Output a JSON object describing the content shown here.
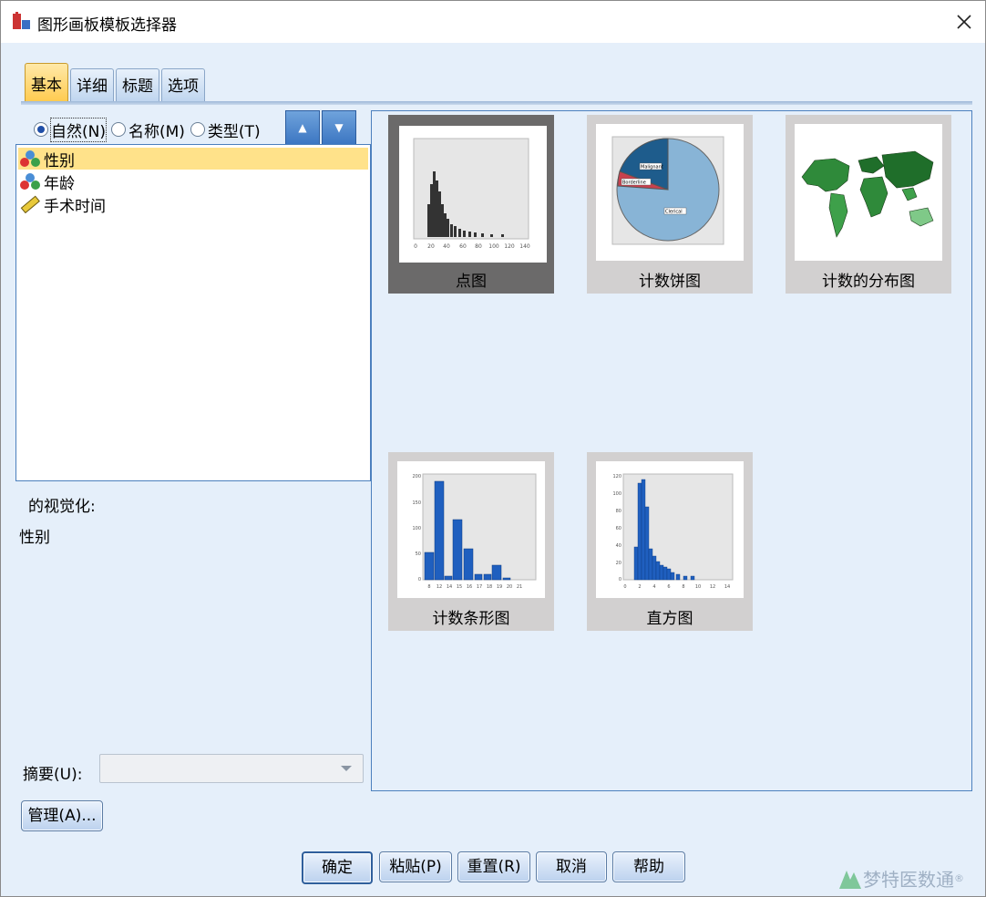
{
  "window": {
    "title": "图形画板模板选择器"
  },
  "tabs": [
    {
      "label": "基本",
      "active": true
    },
    {
      "label": "详细",
      "active": false
    },
    {
      "label": "标题",
      "active": false
    },
    {
      "label": "选项",
      "active": false
    }
  ],
  "sort_options": [
    {
      "label": "自然(N)",
      "selected": true
    },
    {
      "label": "名称(M)",
      "selected": false
    },
    {
      "label": "类型(T)",
      "selected": false
    }
  ],
  "sort_buttons": {
    "ascending_icon": "sort-ascending-icon",
    "descending_icon": "sort-descending-icon"
  },
  "variables": [
    {
      "label": "性别",
      "icon": "nominal-icon",
      "selected": true
    },
    {
      "label": "年龄",
      "icon": "nominal-icon",
      "selected": false
    },
    {
      "label": "手术时间",
      "icon": "scale-ruler-icon",
      "selected": false
    }
  ],
  "visualization": {
    "label": "的视觉化:",
    "value": "性别"
  },
  "summary": {
    "label": "摘要(U):",
    "value": ""
  },
  "manage_button": "管理(A)...",
  "gallery": [
    {
      "label": "点图",
      "selected": true
    },
    {
      "label": "计数饼图",
      "selected": false
    },
    {
      "label": "计数的分布图",
      "selected": false
    },
    {
      "label": "计数条形图",
      "selected": false
    },
    {
      "label": "直方图",
      "selected": false
    }
  ],
  "thumb_labels": {
    "dot_xticks": [
      "0",
      "20",
      "40",
      "60",
      "80",
      "100",
      "120",
      "140"
    ],
    "pie_labels": [
      "Malignant",
      "Borderline",
      "Clerical"
    ],
    "bar_yticks": [
      "200",
      "150",
      "100",
      "50",
      "0"
    ],
    "bar_xticks": [
      "8",
      "12",
      "14",
      "15",
      "16",
      "17",
      "18",
      "19",
      "20",
      "21"
    ],
    "hist_yticks": [
      "120",
      "100",
      "80",
      "60",
      "40",
      "20",
      "0"
    ],
    "hist_xticks": [
      "0",
      "2",
      "4",
      "6",
      "8",
      "10",
      "12",
      "14"
    ]
  },
  "buttons": {
    "ok": "确定",
    "paste": "粘贴(P)",
    "reset": "重置(R)",
    "cancel": "取消",
    "help": "帮助"
  },
  "watermark": {
    "text": "梦特医数通",
    "mark": "®"
  },
  "colors": {
    "accent": "#4c80be",
    "tab_active": "#ffc94a",
    "selected_row": "#ffe28a",
    "bar_blue": "#1f5fbf"
  }
}
